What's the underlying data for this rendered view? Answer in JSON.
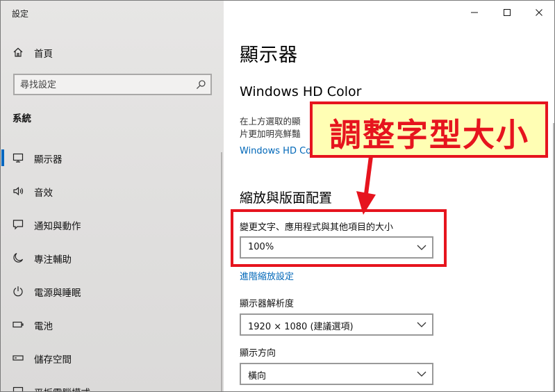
{
  "app": {
    "title": "設定"
  },
  "sidebar": {
    "home_label": "首頁",
    "search_placeholder": "尋找設定",
    "section_label": "系統",
    "items": [
      {
        "label": "顯示器",
        "icon": "monitor-icon",
        "selected": true
      },
      {
        "label": "音效",
        "icon": "speaker-icon"
      },
      {
        "label": "通知與動作",
        "icon": "notification-icon"
      },
      {
        "label": "專注輔助",
        "icon": "moon-icon"
      },
      {
        "label": "電源與睡眠",
        "icon": "power-icon"
      },
      {
        "label": "電池",
        "icon": "battery-icon"
      },
      {
        "label": "儲存空間",
        "icon": "storage-icon"
      },
      {
        "label": "平板電腦模式",
        "icon": "tablet-icon"
      }
    ]
  },
  "content": {
    "page_title": "顯示器",
    "hd_color": {
      "heading": "Windows HD Color",
      "desc_line1": "在上方選取的顯",
      "desc_line2": "片更加明亮鮮豔",
      "link": "Windows HD Co"
    },
    "scale_layout": {
      "heading": "縮放與版面配置",
      "scale_label": "變更文字、應用程式與其他項目的大小",
      "scale_value": "100%",
      "advanced_link": "進階縮放設定",
      "resolution_label": "顯示器解析度",
      "resolution_value": "1920 × 1080 (建議選項)",
      "orientation_label": "顯示方向",
      "orientation_value": "橫向"
    }
  },
  "annotation": {
    "callout_text": "調整字型大小",
    "color": "#e6141e",
    "callout_bg": "#fffeb4"
  },
  "colors": {
    "accent": "#0067c0",
    "link": "#0067b8",
    "sidebar_bg": "#e1e0df"
  }
}
